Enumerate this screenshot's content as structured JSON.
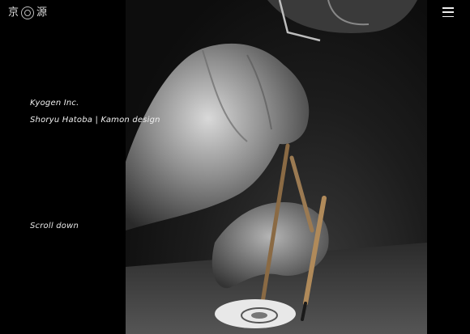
{
  "header": {
    "logo": {
      "char_left": "京",
      "char_right": "源"
    },
    "menu_icon": "hamburger-icon"
  },
  "hero": {
    "company": "Kyogen Inc.",
    "artist_line": "Shoryu Hatoba | Kamon design",
    "scroll_label": "Scroll down"
  },
  "colors": {
    "background": "#000000",
    "text": "#f0f0f0"
  }
}
